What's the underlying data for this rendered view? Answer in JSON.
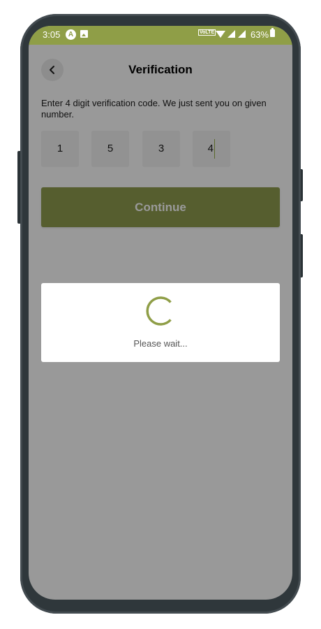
{
  "status_bar": {
    "time": "3:05",
    "app_icon": "A",
    "volte_label": "VoLTE",
    "battery_percent": "63%",
    "icons": [
      "app-notification-icon",
      "image-icon",
      "volte-icon",
      "wifi-icon",
      "signal-icon",
      "signal-icon",
      "battery-icon"
    ]
  },
  "header": {
    "title": "Verification",
    "back_icon": "chevron-left-icon"
  },
  "instruction": "Enter 4 digit verification code. We just sent you on given number.",
  "otp": {
    "digits": [
      "1",
      "5",
      "3",
      "4"
    ],
    "active_index": 3
  },
  "continue_button": {
    "label": "Continue"
  },
  "loading_dialog": {
    "message": "Please wait..."
  },
  "colors": {
    "accent": "#8f9e47",
    "overlay": "#999999",
    "button": "#565e2f"
  }
}
